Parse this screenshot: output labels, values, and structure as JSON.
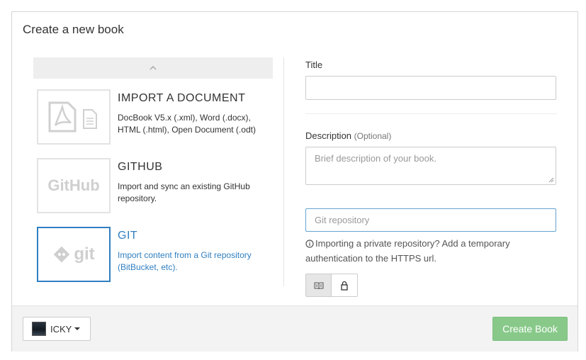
{
  "modal": {
    "title": "Create a new book"
  },
  "sources": [
    {
      "name": "IMPORT A DOCUMENT",
      "description": "DocBook V5.x (.xml), Word (.docx), HTML (.html), Open Document (.odt)",
      "icon": "pdf-document-icon",
      "selected": false
    },
    {
      "name": "GITHUB",
      "description": "Import and sync an existing GitHub repository.",
      "logo_text": "GitHub",
      "selected": false
    },
    {
      "name": "GIT",
      "description": "Import content from a Git repository (BitBucket, etc).",
      "logo_text": "git",
      "selected": true
    }
  ],
  "form": {
    "title_label": "Title",
    "title_value": "",
    "description_label": "Description",
    "description_optional": "(Optional)",
    "description_placeholder": "Brief description of your book.",
    "git_placeholder": "Git repository",
    "info_text": "Importing a private repository? Add a temporary authentication to the HTTPS url."
  },
  "footer": {
    "owner_name": "ICKY",
    "create_label": "Create Book"
  },
  "colors": {
    "accent": "#2f7fc1",
    "create_button": "#88c98a",
    "footer_bg": "#f3f3f3"
  }
}
